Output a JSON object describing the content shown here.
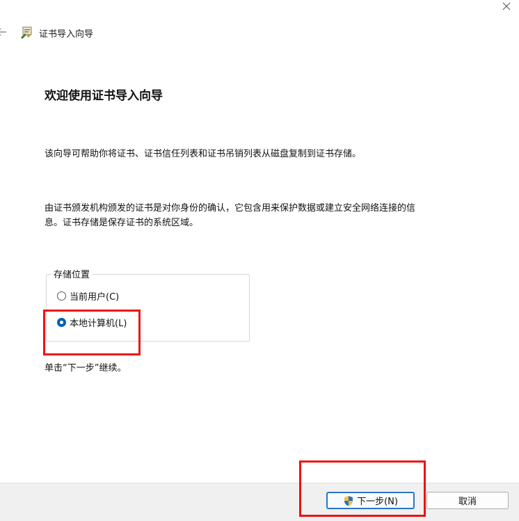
{
  "window": {
    "title": "证书导入向导"
  },
  "heading": "欢迎使用证书导入向导",
  "paragraphs": {
    "intro": "该向导可帮助你将证书、证书信任列表和证书吊销列表从磁盘复制到证书存储。",
    "detail_line1": "由证书颁发机构颁发的证书是对你身份的确认，它包含用来保护数据或建立安全网络连接的信",
    "detail_line2": "息。证书存储是保存证书的系统区域。"
  },
  "store_location": {
    "legend": "存储位置",
    "options": [
      {
        "label": "当前用户(C)",
        "checked": false
      },
      {
        "label": "本地计算机(L)",
        "checked": true
      }
    ]
  },
  "continue_text": "单击“下一步”继续。",
  "buttons": {
    "next": "下一步(N)",
    "cancel": "取消"
  },
  "icons": {
    "close": "close-icon",
    "back": "back-arrow-icon",
    "wizard": "certificate-icon",
    "shield": "uac-shield-icon"
  },
  "colors": {
    "accent": "#005fb8",
    "highlight": "#ee1111",
    "footer_bg": "#f0f0f0"
  }
}
